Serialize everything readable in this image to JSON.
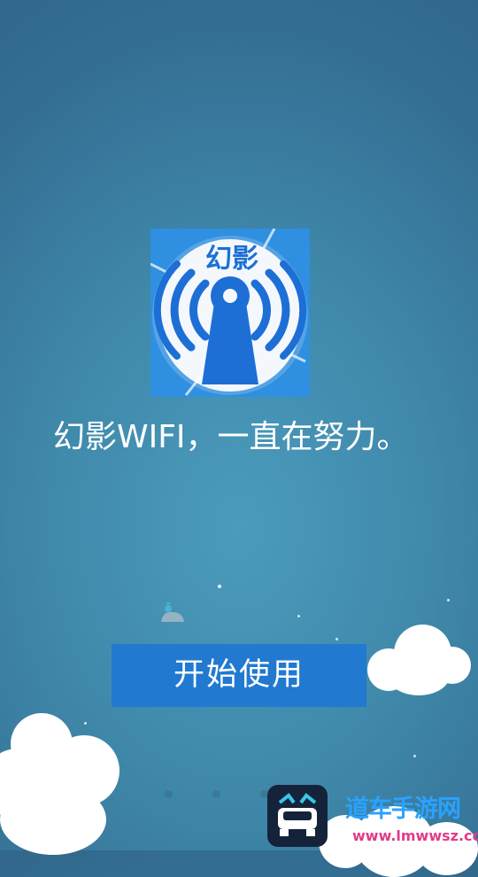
{
  "app": {
    "logo_text": "幻影",
    "tagline": "幻影WIFI，一直在努力。",
    "start_button": "开始使用"
  },
  "watermark": {
    "title": "道车手游网",
    "url": "www.lmwwsz.com"
  },
  "colors": {
    "background": "#3f88aa",
    "button": "#2179d0",
    "logo_bg": "#2f8fe0",
    "logo_accent": "#1d6fd6"
  },
  "icons": [
    "wifi-logo-icon",
    "whale-icon",
    "cloud-icon",
    "car-icon"
  ]
}
